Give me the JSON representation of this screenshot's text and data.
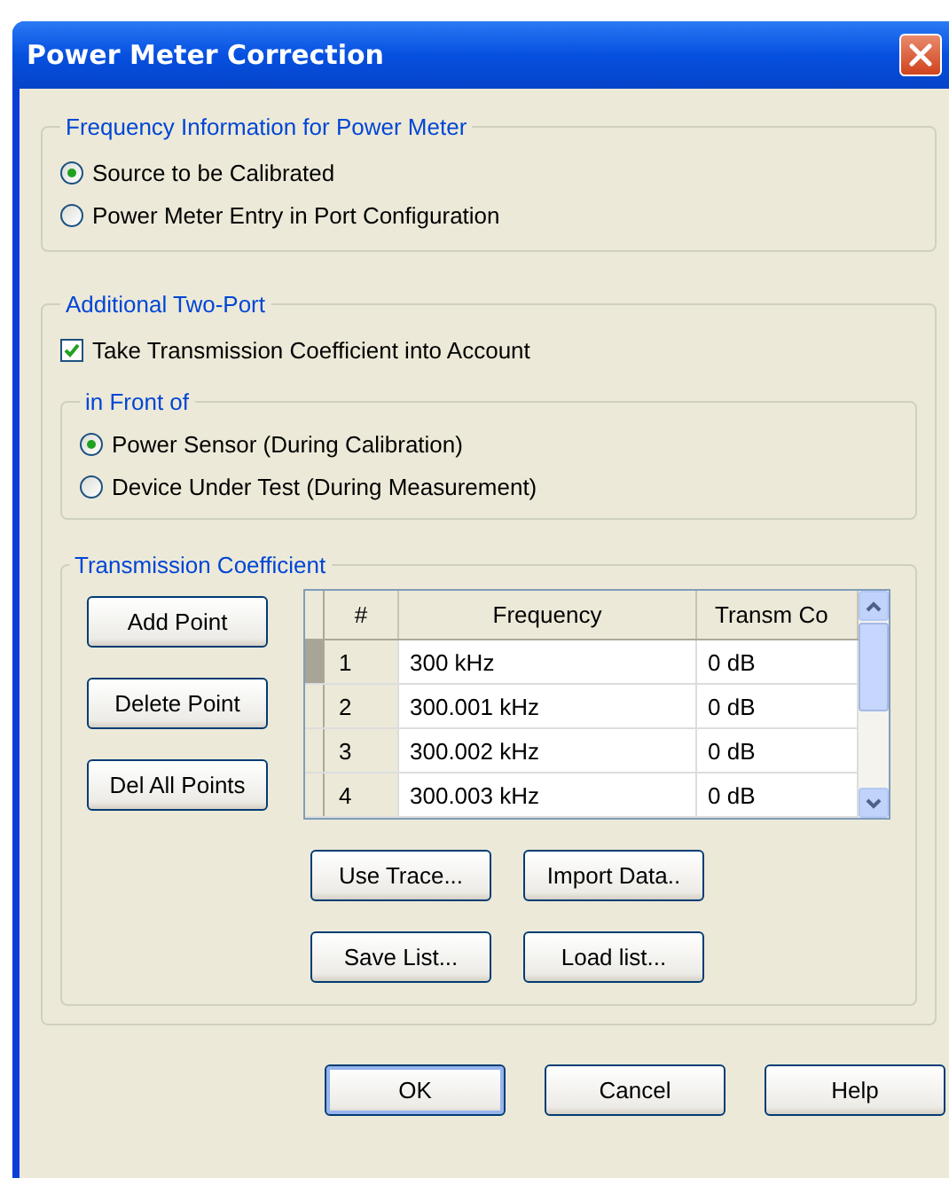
{
  "window": {
    "title": "Power Meter Correction"
  },
  "frequency_group": {
    "title": "Frequency Information for Power Meter",
    "options": [
      {
        "label": "Source to be Calibrated",
        "selected": true
      },
      {
        "label": "Power Meter Entry in Port Configuration",
        "selected": false
      }
    ]
  },
  "two_port_group": {
    "title": "Additional Two-Port",
    "checkbox": {
      "label": "Take Transmission Coefficient into Account",
      "checked": true
    },
    "front_group": {
      "title": "in Front of",
      "options": [
        {
          "label": "Power Sensor (During Calibration)",
          "selected": true
        },
        {
          "label": "Device Under Test (During Measurement)",
          "selected": false
        }
      ]
    },
    "transmission_group": {
      "title": "Transmission Coefficient",
      "side_buttons": [
        "Add Point",
        "Delete Point",
        "Del All Points"
      ],
      "table": {
        "columns": [
          "#",
          "Frequency",
          "Transm Co"
        ],
        "rows": [
          {
            "cells": [
              "1",
              "300 kHz",
              "0 dB"
            ],
            "selected": true
          },
          {
            "cells": [
              "2",
              "300.001 kHz",
              "0 dB"
            ],
            "selected": false
          },
          {
            "cells": [
              "3",
              "300.002 kHz",
              "0 dB"
            ],
            "selected": false
          },
          {
            "cells": [
              "4",
              "300.003 kHz",
              "0 dB"
            ],
            "selected": false
          }
        ]
      },
      "button_rows": [
        [
          "Use Trace...",
          "Import Data.."
        ],
        [
          "Save List...",
          "Load list..."
        ]
      ]
    }
  },
  "buttons": [
    "OK",
    "Cancel",
    "Help"
  ]
}
